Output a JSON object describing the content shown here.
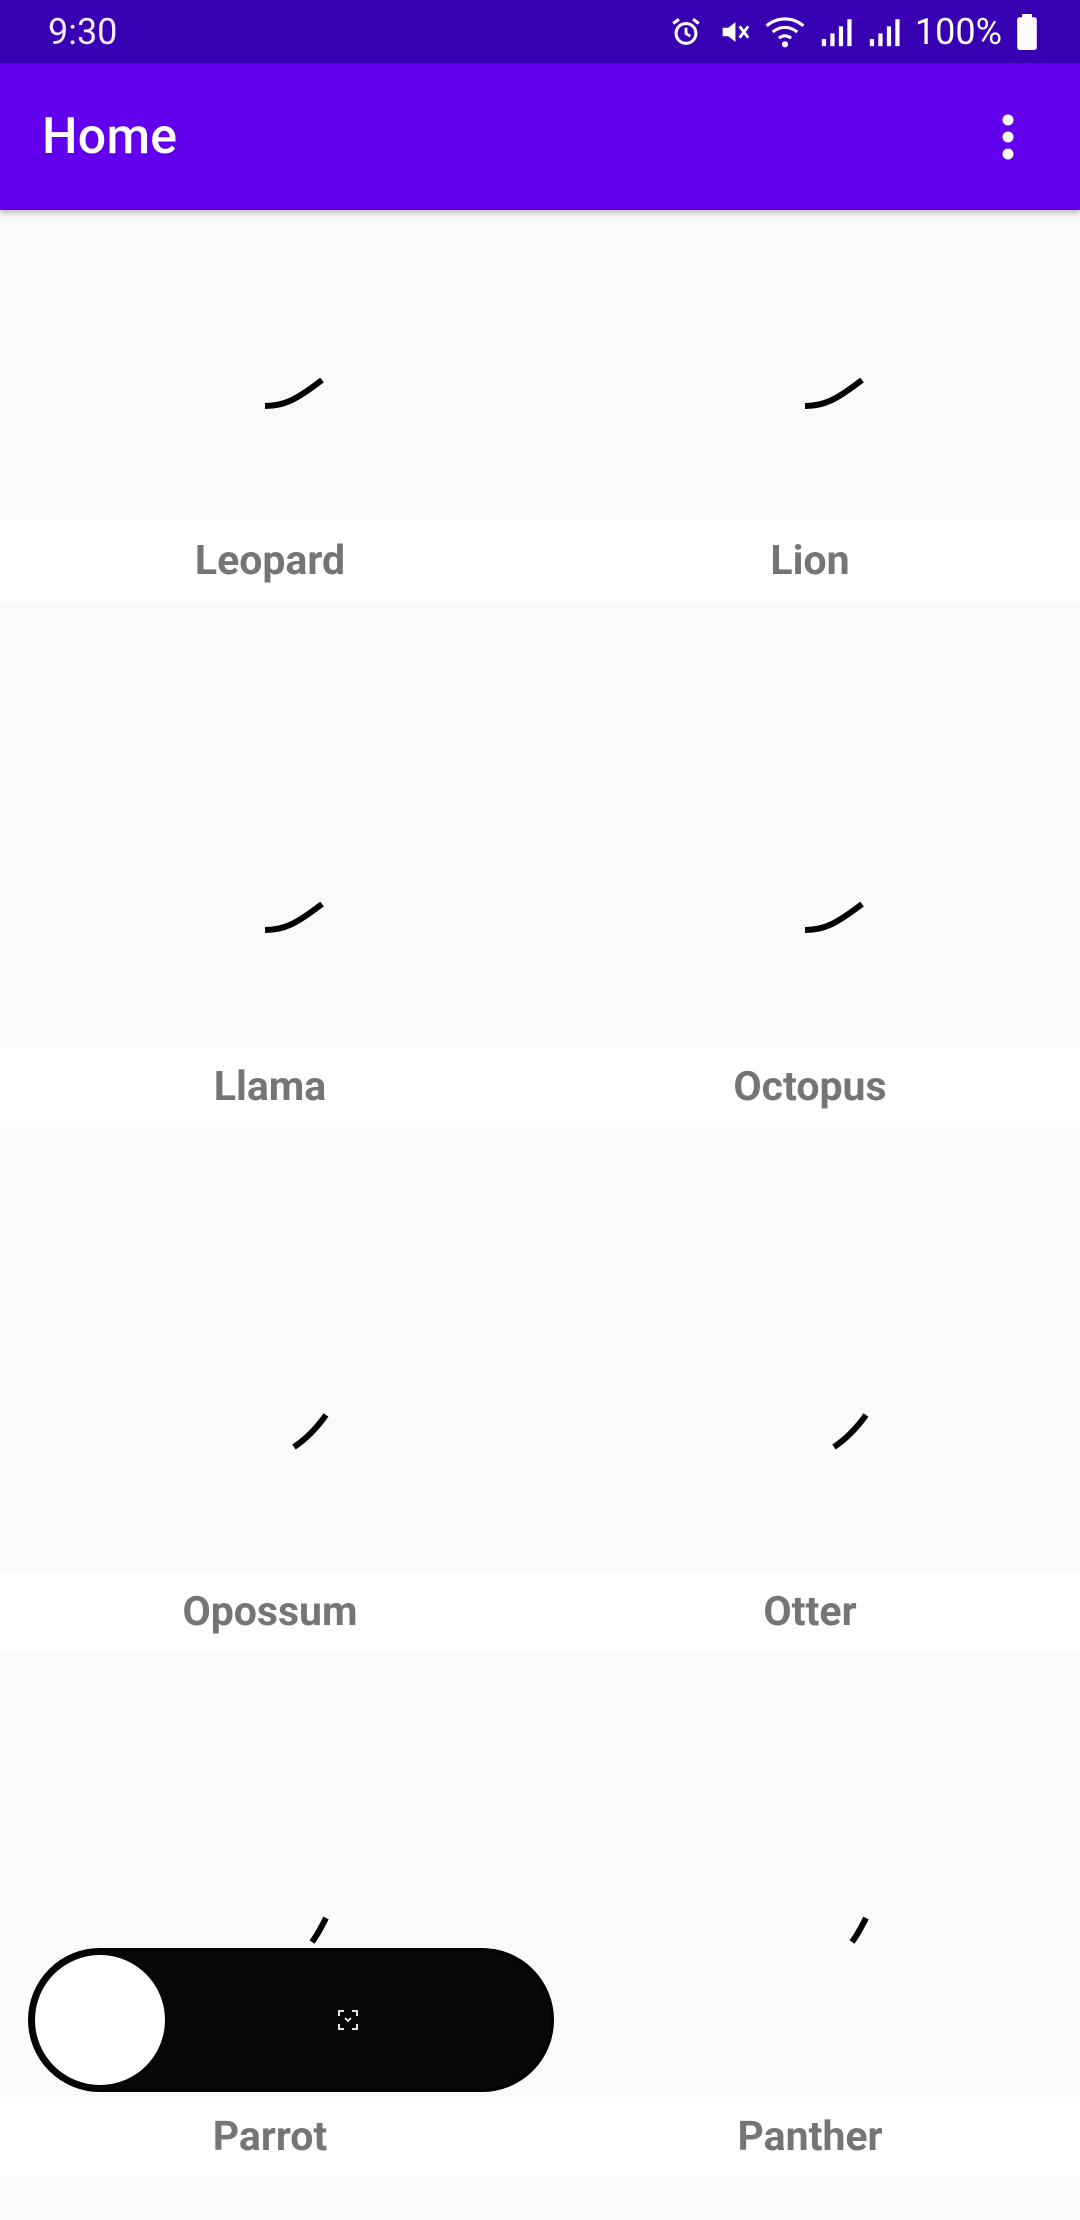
{
  "status_bar": {
    "time": "9:30",
    "battery_text": "100%",
    "icons": [
      "alarm-icon",
      "mute-icon",
      "wifi-icon",
      "signal-icon",
      "signal-icon",
      "battery-icon"
    ]
  },
  "app_bar": {
    "title": "Home",
    "overflow_icon": "more-vert-icon"
  },
  "grid": {
    "items": [
      {
        "label": "Leopard"
      },
      {
        "label": "Lion"
      },
      {
        "label": "Llama"
      },
      {
        "label": "Octopus"
      },
      {
        "label": "Opossum"
      },
      {
        "label": "Otter"
      },
      {
        "label": "Parrot"
      },
      {
        "label": "Panther"
      }
    ]
  },
  "colors": {
    "status_bar": "#3700b3",
    "app_bar": "#6200ee",
    "label_text": "#757575"
  }
}
